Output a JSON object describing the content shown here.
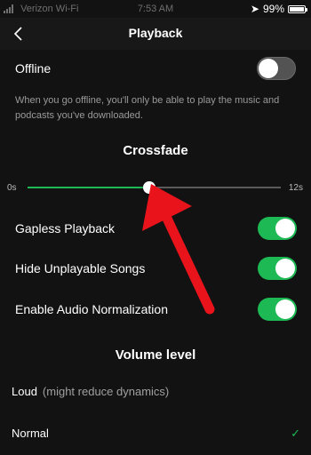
{
  "status_bar": {
    "carrier": "Verizon Wi-Fi",
    "time": "7:53 AM",
    "battery_percent": "99%",
    "battery_level": 0.99
  },
  "nav": {
    "title": "Playback",
    "back_icon": "chevron-left-icon"
  },
  "offline": {
    "label": "Offline",
    "enabled": false,
    "description": "When you go offline, you'll only be able to play the music and podcasts you've downloaded."
  },
  "crossfade": {
    "title": "Crossfade",
    "min_label": "0s",
    "max_label": "12s",
    "value_fraction": 0.48
  },
  "toggles": [
    {
      "label": "Gapless Playback",
      "enabled": true
    },
    {
      "label": "Hide Unplayable Songs",
      "enabled": true
    },
    {
      "label": "Enable Audio Normalization",
      "enabled": true
    }
  ],
  "volume": {
    "title": "Volume level",
    "options": [
      {
        "label": "Loud",
        "note": "(might reduce dynamics)",
        "selected": false
      },
      {
        "label": "Normal",
        "note": "",
        "selected": true
      }
    ]
  },
  "colors": {
    "accent": "#1db954",
    "background": "#121212",
    "annotation_arrow": "#e8131b"
  }
}
